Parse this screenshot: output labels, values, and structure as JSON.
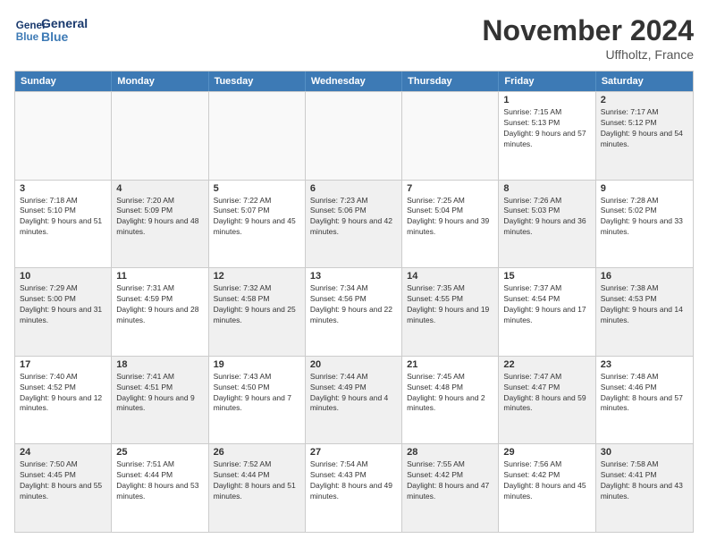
{
  "logo": {
    "line1": "General",
    "line2": "Blue"
  },
  "title": "November 2024",
  "subtitle": "Uffholtz, France",
  "headers": [
    "Sunday",
    "Monday",
    "Tuesday",
    "Wednesday",
    "Thursday",
    "Friday",
    "Saturday"
  ],
  "rows": [
    [
      {
        "day": "",
        "info": "",
        "empty": true
      },
      {
        "day": "",
        "info": "",
        "empty": true
      },
      {
        "day": "",
        "info": "",
        "empty": true
      },
      {
        "day": "",
        "info": "",
        "empty": true
      },
      {
        "day": "",
        "info": "",
        "empty": true
      },
      {
        "day": "1",
        "info": "Sunrise: 7:15 AM\nSunset: 5:13 PM\nDaylight: 9 hours and 57 minutes.",
        "empty": false
      },
      {
        "day": "2",
        "info": "Sunrise: 7:17 AM\nSunset: 5:12 PM\nDaylight: 9 hours and 54 minutes.",
        "empty": false,
        "shaded": true
      }
    ],
    [
      {
        "day": "3",
        "info": "Sunrise: 7:18 AM\nSunset: 5:10 PM\nDaylight: 9 hours and 51 minutes.",
        "empty": false
      },
      {
        "day": "4",
        "info": "Sunrise: 7:20 AM\nSunset: 5:09 PM\nDaylight: 9 hours and 48 minutes.",
        "empty": false,
        "shaded": true
      },
      {
        "day": "5",
        "info": "Sunrise: 7:22 AM\nSunset: 5:07 PM\nDaylight: 9 hours and 45 minutes.",
        "empty": false
      },
      {
        "day": "6",
        "info": "Sunrise: 7:23 AM\nSunset: 5:06 PM\nDaylight: 9 hours and 42 minutes.",
        "empty": false,
        "shaded": true
      },
      {
        "day": "7",
        "info": "Sunrise: 7:25 AM\nSunset: 5:04 PM\nDaylight: 9 hours and 39 minutes.",
        "empty": false
      },
      {
        "day": "8",
        "info": "Sunrise: 7:26 AM\nSunset: 5:03 PM\nDaylight: 9 hours and 36 minutes.",
        "empty": false,
        "shaded": true
      },
      {
        "day": "9",
        "info": "Sunrise: 7:28 AM\nSunset: 5:02 PM\nDaylight: 9 hours and 33 minutes.",
        "empty": false
      }
    ],
    [
      {
        "day": "10",
        "info": "Sunrise: 7:29 AM\nSunset: 5:00 PM\nDaylight: 9 hours and 31 minutes.",
        "empty": false,
        "shaded": true
      },
      {
        "day": "11",
        "info": "Sunrise: 7:31 AM\nSunset: 4:59 PM\nDaylight: 9 hours and 28 minutes.",
        "empty": false
      },
      {
        "day": "12",
        "info": "Sunrise: 7:32 AM\nSunset: 4:58 PM\nDaylight: 9 hours and 25 minutes.",
        "empty": false,
        "shaded": true
      },
      {
        "day": "13",
        "info": "Sunrise: 7:34 AM\nSunset: 4:56 PM\nDaylight: 9 hours and 22 minutes.",
        "empty": false
      },
      {
        "day": "14",
        "info": "Sunrise: 7:35 AM\nSunset: 4:55 PM\nDaylight: 9 hours and 19 minutes.",
        "empty": false,
        "shaded": true
      },
      {
        "day": "15",
        "info": "Sunrise: 7:37 AM\nSunset: 4:54 PM\nDaylight: 9 hours and 17 minutes.",
        "empty": false
      },
      {
        "day": "16",
        "info": "Sunrise: 7:38 AM\nSunset: 4:53 PM\nDaylight: 9 hours and 14 minutes.",
        "empty": false,
        "shaded": true
      }
    ],
    [
      {
        "day": "17",
        "info": "Sunrise: 7:40 AM\nSunset: 4:52 PM\nDaylight: 9 hours and 12 minutes.",
        "empty": false
      },
      {
        "day": "18",
        "info": "Sunrise: 7:41 AM\nSunset: 4:51 PM\nDaylight: 9 hours and 9 minutes.",
        "empty": false,
        "shaded": true
      },
      {
        "day": "19",
        "info": "Sunrise: 7:43 AM\nSunset: 4:50 PM\nDaylight: 9 hours and 7 minutes.",
        "empty": false
      },
      {
        "day": "20",
        "info": "Sunrise: 7:44 AM\nSunset: 4:49 PM\nDaylight: 9 hours and 4 minutes.",
        "empty": false,
        "shaded": true
      },
      {
        "day": "21",
        "info": "Sunrise: 7:45 AM\nSunset: 4:48 PM\nDaylight: 9 hours and 2 minutes.",
        "empty": false
      },
      {
        "day": "22",
        "info": "Sunrise: 7:47 AM\nSunset: 4:47 PM\nDaylight: 8 hours and 59 minutes.",
        "empty": false,
        "shaded": true
      },
      {
        "day": "23",
        "info": "Sunrise: 7:48 AM\nSunset: 4:46 PM\nDaylight: 8 hours and 57 minutes.",
        "empty": false
      }
    ],
    [
      {
        "day": "24",
        "info": "Sunrise: 7:50 AM\nSunset: 4:45 PM\nDaylight: 8 hours and 55 minutes.",
        "empty": false,
        "shaded": true
      },
      {
        "day": "25",
        "info": "Sunrise: 7:51 AM\nSunset: 4:44 PM\nDaylight: 8 hours and 53 minutes.",
        "empty": false
      },
      {
        "day": "26",
        "info": "Sunrise: 7:52 AM\nSunset: 4:44 PM\nDaylight: 8 hours and 51 minutes.",
        "empty": false,
        "shaded": true
      },
      {
        "day": "27",
        "info": "Sunrise: 7:54 AM\nSunset: 4:43 PM\nDaylight: 8 hours and 49 minutes.",
        "empty": false
      },
      {
        "day": "28",
        "info": "Sunrise: 7:55 AM\nSunset: 4:42 PM\nDaylight: 8 hours and 47 minutes.",
        "empty": false,
        "shaded": true
      },
      {
        "day": "29",
        "info": "Sunrise: 7:56 AM\nSunset: 4:42 PM\nDaylight: 8 hours and 45 minutes.",
        "empty": false
      },
      {
        "day": "30",
        "info": "Sunrise: 7:58 AM\nSunset: 4:41 PM\nDaylight: 8 hours and 43 minutes.",
        "empty": false,
        "shaded": true
      }
    ]
  ]
}
